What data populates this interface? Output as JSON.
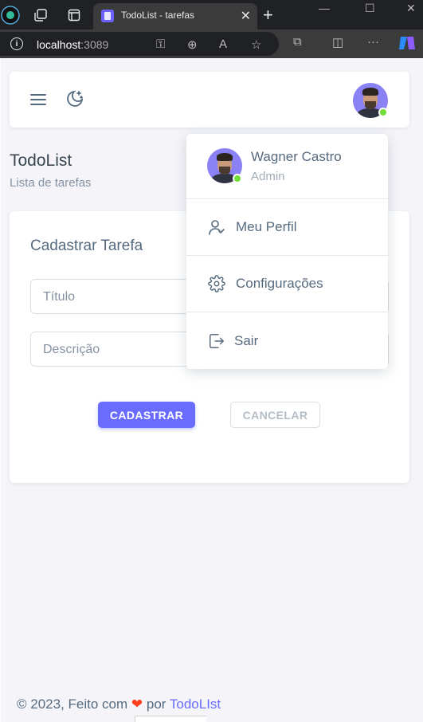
{
  "browser": {
    "tab_title": "TodoList - tarefas",
    "url_host": "localhost",
    "url_port": ":3089"
  },
  "page": {
    "title": "TodoList",
    "subtitle": "Lista de tarefas"
  },
  "form": {
    "title": "Cadastrar Tarefa",
    "title_placeholder": "Título",
    "description_placeholder": "Descrição",
    "submit_label": "CADASTRAR",
    "cancel_label": "CANCELAR"
  },
  "user_menu": {
    "name": "Wagner Castro",
    "role": "Admin",
    "items": [
      {
        "label": "Meu Perfil",
        "icon": "user-check-icon"
      },
      {
        "label": "Configurações",
        "icon": "gear-icon"
      },
      {
        "label": "Sair",
        "icon": "logout-icon"
      }
    ]
  },
  "footer": {
    "prefix": "© 2023, Feito com",
    "heart": "❤",
    "by": "por",
    "brand": "TodoLIst"
  },
  "colors": {
    "primary": "#696cff",
    "online": "#71dd37",
    "heart": "#ff3e1d"
  }
}
